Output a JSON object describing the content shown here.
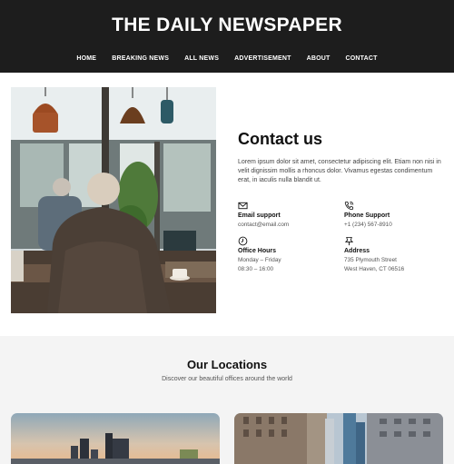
{
  "site": {
    "title": "THE DAILY NEWSPAPER"
  },
  "nav": {
    "items": [
      "HOME",
      "BREAKING NEWS",
      "ALL NEWS",
      "ADVERTISEMENT",
      "ABOUT",
      "CONTACT"
    ]
  },
  "contact": {
    "title": "Contact us",
    "body": "Lorem ipsum dolor sit amet, consectetur adipiscing elit. Etiam non nisi in velit dignissim mollis a rhoncus dolor. Vivamus egestas condimentum erat, in iaculis nulla blandit ut.",
    "email": {
      "label": "Email support",
      "value": "contact@email.com",
      "icon": "envelope-icon"
    },
    "phone": {
      "label": "Phone Support",
      "value": "+1 (234) 567-8910",
      "icon": "phone-icon"
    },
    "hours": {
      "label": "Office Hours",
      "line1": "Monday – Friday",
      "line2": "08:30 – 16:00",
      "icon": "clock-icon"
    },
    "address": {
      "label": "Address",
      "line1": "735 Plymouth Street",
      "line2": "West Haven, CT 06516",
      "icon": "map-pin-icon"
    }
  },
  "locations": {
    "title": "Our Locations",
    "subtitle": "Discover our beautiful offices around the world"
  },
  "colors": {
    "header_bg": "#1d1d1d",
    "section_bg": "#f4f4f4",
    "text": "#111111"
  }
}
